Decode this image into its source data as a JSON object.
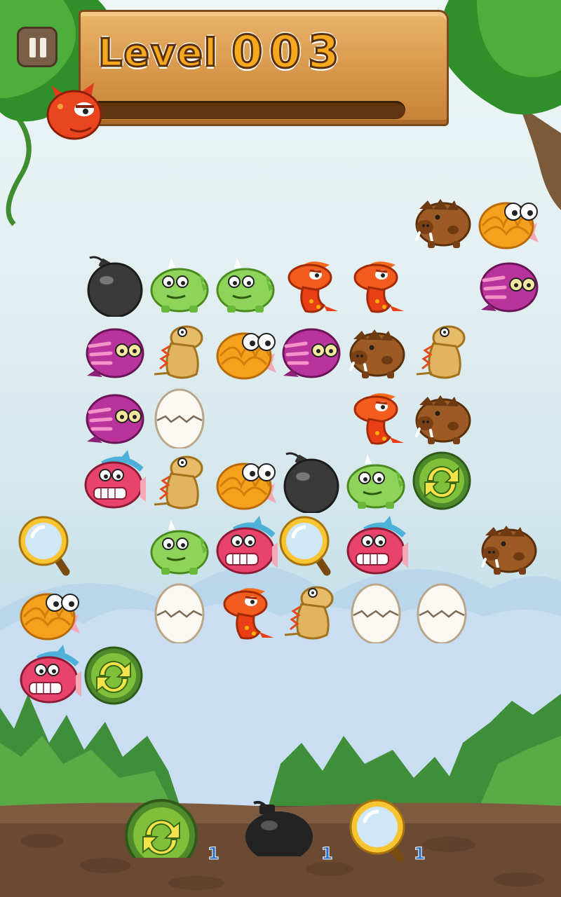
{
  "header": {
    "level_label": "Level",
    "level_number": "003",
    "progress_fraction": 0.0
  },
  "colors": {
    "wood": "#d59448",
    "wood_dark": "#7a4a1c",
    "sky": "#d4e7ec",
    "ground": "#6b4a34",
    "grass": "#3d8a3a",
    "count_text": "#2a72c7"
  },
  "board": {
    "tiles": [
      {
        "row": 0,
        "col": 6,
        "type": "boar"
      },
      {
        "row": 0,
        "col": 7,
        "type": "fish"
      },
      {
        "row": 1,
        "col": 1,
        "type": "bomb"
      },
      {
        "row": 1,
        "col": 2,
        "type": "green-dino"
      },
      {
        "row": 1,
        "col": 3,
        "type": "green-dino"
      },
      {
        "row": 1,
        "col": 4,
        "type": "red-dino"
      },
      {
        "row": 1,
        "col": 5,
        "type": "red-dino"
      },
      {
        "row": 1,
        "col": 7,
        "type": "purple-monster"
      },
      {
        "row": 2,
        "col": 1,
        "type": "purple-monster"
      },
      {
        "row": 2,
        "col": 2,
        "type": "tan-dino"
      },
      {
        "row": 2,
        "col": 3,
        "type": "fish"
      },
      {
        "row": 2,
        "col": 4,
        "type": "purple-monster"
      },
      {
        "row": 2,
        "col": 5,
        "type": "boar"
      },
      {
        "row": 2,
        "col": 6,
        "type": "tan-dino"
      },
      {
        "row": 3,
        "col": 1,
        "type": "purple-monster"
      },
      {
        "row": 3,
        "col": 2,
        "type": "egg"
      },
      {
        "row": 3,
        "col": 5,
        "type": "red-dino"
      },
      {
        "row": 3,
        "col": 6,
        "type": "boar"
      },
      {
        "row": 4,
        "col": 1,
        "type": "pink-fish"
      },
      {
        "row": 4,
        "col": 2,
        "type": "tan-dino"
      },
      {
        "row": 4,
        "col": 3,
        "type": "fish"
      },
      {
        "row": 4,
        "col": 4,
        "type": "bomb"
      },
      {
        "row": 4,
        "col": 5,
        "type": "green-dino"
      },
      {
        "row": 4,
        "col": 6,
        "type": "shuffle"
      },
      {
        "row": 5,
        "col": 0,
        "type": "magnifier"
      },
      {
        "row": 5,
        "col": 2,
        "type": "green-dino"
      },
      {
        "row": 5,
        "col": 3,
        "type": "pink-fish"
      },
      {
        "row": 5,
        "col": 4,
        "type": "magnifier"
      },
      {
        "row": 5,
        "col": 5,
        "type": "pink-fish"
      },
      {
        "row": 5,
        "col": 7,
        "type": "boar"
      },
      {
        "row": 6,
        "col": 0,
        "type": "fish"
      },
      {
        "row": 6,
        "col": 2,
        "type": "egg"
      },
      {
        "row": 6,
        "col": 3,
        "type": "red-dino"
      },
      {
        "row": 6,
        "col": 4,
        "type": "tan-dino"
      },
      {
        "row": 6,
        "col": 5,
        "type": "egg"
      },
      {
        "row": 6,
        "col": 6,
        "type": "egg"
      },
      {
        "row": 7,
        "col": 0,
        "type": "pink-fish"
      },
      {
        "row": 7,
        "col": 1,
        "type": "shuffle"
      }
    ]
  },
  "powerups": [
    {
      "name": "shuffle",
      "icon": "shuffle-icon",
      "count": "1"
    },
    {
      "name": "bomb",
      "icon": "bomb-icon",
      "count": "1"
    },
    {
      "name": "hint",
      "icon": "magnifier-icon",
      "count": "1"
    }
  ]
}
